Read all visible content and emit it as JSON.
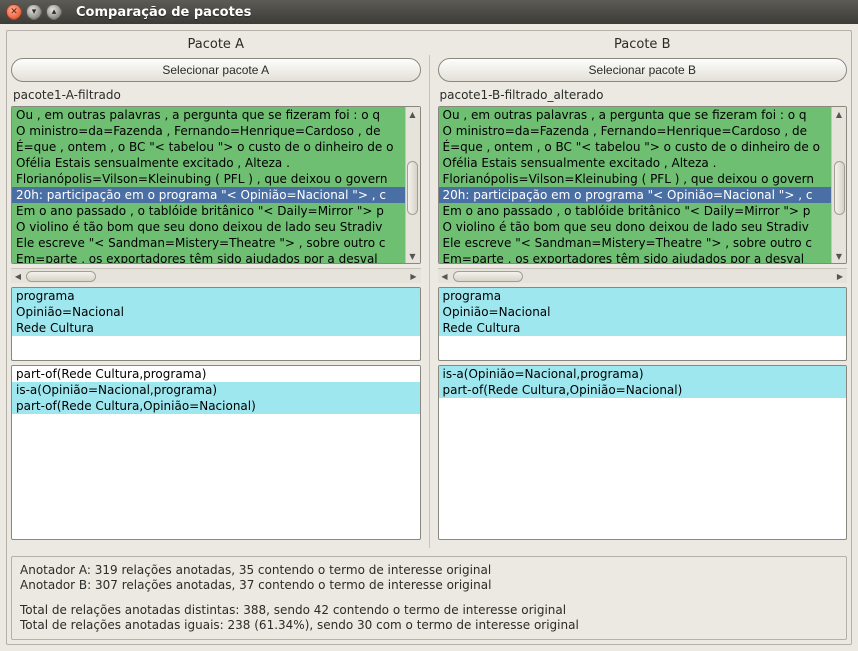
{
  "window": {
    "title": "Comparação de pacotes"
  },
  "panelA": {
    "header": "Pacote A",
    "select_label": "Selecionar pacote A",
    "filename": "pacote1-A-filtrado",
    "text_rows": [
      "Ou , em outras palavras , a pergunta que se fizeram foi : o q",
      "O ministro=da=Fazenda , Fernando=Henrique=Cardoso , de",
      "É=que , ontem , o BC \"< tabelou \"> o custo de o dinheiro de o",
      "Ofélia Estais sensualmente excitado , Alteza .",
      "Florianópolis=Vilson=Kleinubing ( PFL ) , que deixou o govern",
      "20h: participação em o programa \"< Opinião=Nacional \">  , c",
      "Em o ano passado , o tablóide britânico \"< Daily=Mirror \"> p",
      "O violino é tão bom que seu dono deixou de lado seu Stradiv",
      "Ele escreve \"< Sandman=Mistery=Theatre \"> , sobre outro c",
      "Em=parte , os exportadores têm sido ajudados por a desval"
    ],
    "terms": [
      "programa",
      "Opinião=Nacional",
      "Rede Cultura"
    ],
    "relations": [
      "part-of(Rede Cultura,programa)",
      "is-a(Opinião=Nacional,programa)",
      "part-of(Rede Cultura,Opinião=Nacional)"
    ]
  },
  "panelB": {
    "header": "Pacote B",
    "select_label": "Selecionar pacote B",
    "filename": "pacote1-B-filtrado_alterado",
    "text_rows": [
      "Ou , em outras palavras , a pergunta que se fizeram foi : o q",
      "O ministro=da=Fazenda , Fernando=Henrique=Cardoso , de",
      "É=que , ontem , o BC \"< tabelou \"> o custo de o dinheiro de o",
      "Ofélia Estais sensualmente excitado , Alteza .",
      "Florianópolis=Vilson=Kleinubing ( PFL ) , que deixou o govern",
      "20h: participação em o programa \"< Opinião=Nacional \">  , c",
      "Em o ano passado , o tablóide britânico \"< Daily=Mirror \"> p",
      "O violino é tão bom que seu dono deixou de lado seu Stradiv",
      "Ele escreve \"< Sandman=Mistery=Theatre \"> , sobre outro c",
      "Em=parte , os exportadores têm sido ajudados por a desval"
    ],
    "terms": [
      "programa",
      "Opinião=Nacional",
      "Rede Cultura"
    ],
    "relations": [
      "is-a(Opinião=Nacional,programa)",
      "part-of(Rede Cultura,Opinião=Nacional)"
    ]
  },
  "stats": {
    "line1": "Anotador A: 319 relações anotadas, 35 contendo o termo de interesse original",
    "line2": "Anotador B: 307 relações anotadas, 37 contendo o termo de interesse original",
    "line3": "Total de relações anotadas distintas: 388, sendo 42 contendo o termo de interesse original",
    "line4": "Total de relações anotadas iguais: 238 (61.34%), sendo 30 com o termo de interesse original"
  },
  "row_styles": {
    "text": [
      "green",
      "green",
      "green",
      "green",
      "green",
      "blue-sel",
      "green",
      "green",
      "green",
      "green"
    ],
    "termsA": [
      "cyan",
      "cyan",
      "cyan"
    ],
    "termsB": [
      "cyan",
      "cyan",
      "cyan"
    ],
    "relA": [
      "white",
      "cyan",
      "cyan"
    ],
    "relB": [
      "cyan",
      "cyan"
    ]
  }
}
